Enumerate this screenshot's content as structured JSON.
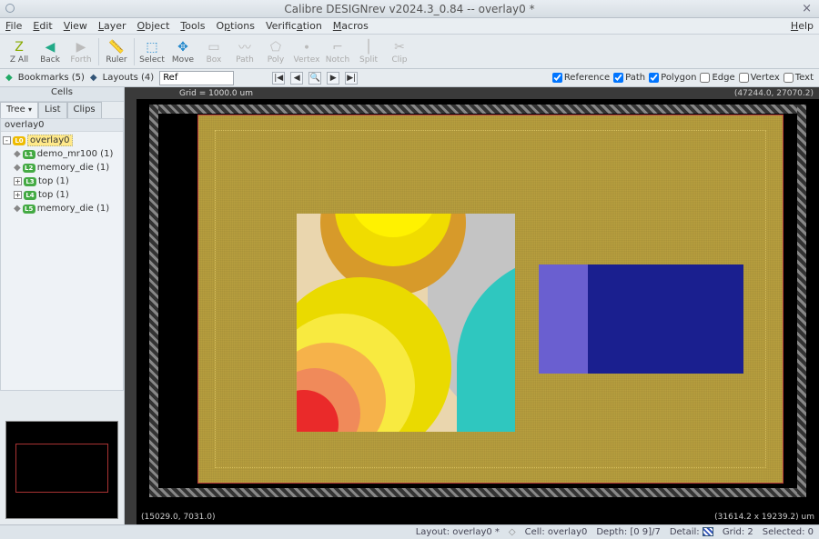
{
  "window": {
    "title": "Calibre DESIGNrev v2024.3_0.84  --  overlay0 *"
  },
  "menu": {
    "file": "File",
    "edit": "Edit",
    "view": "View",
    "layer": "Layer",
    "object": "Object",
    "tools": "Tools",
    "options": "Options",
    "verification": "Verification",
    "macros": "Macros",
    "help": "Help"
  },
  "toolbar": {
    "zall": "Z All",
    "back": "Back",
    "forth": "Forth",
    "ruler": "Ruler",
    "select": "Select",
    "move": "Move",
    "box": "Box",
    "path": "Path",
    "poly": "Poly",
    "vertex": "Vertex",
    "notch": "Notch",
    "split": "Split",
    "clip": "Clip"
  },
  "secbar": {
    "bookmarks": "Bookmarks (5)",
    "layouts": "Layouts (4)",
    "ref_value": "Ref",
    "nav_first": "|◀",
    "nav_prev": "◀",
    "nav_zoom": "🔍",
    "nav_next": "▶",
    "nav_last": "▶|"
  },
  "checks": {
    "reference": "Reference",
    "path": "Path",
    "polygon": "Polygon",
    "edge": "Edge",
    "vertex": "Vertex",
    "text": "Text"
  },
  "sidebar": {
    "header": "Cells",
    "tabs": {
      "tree": "Tree",
      "list": "List",
      "clips": "Clips"
    },
    "root": "overlay0",
    "items": [
      {
        "badge": "L0",
        "label": "overlay0",
        "hl": true
      },
      {
        "badge": "L1",
        "label": "demo_mr100  (1)"
      },
      {
        "badge": "L2",
        "label": "memory_die  (1)"
      },
      {
        "badge": "L3",
        "label": "top  (1)"
      },
      {
        "badge": "L4",
        "label": "top  (1)"
      },
      {
        "badge": "L5",
        "label": "memory_die  (1)"
      }
    ]
  },
  "canvas": {
    "grid_label": "Grid = 1000.0 um",
    "coord_tr": "(47244.0, 27070.2)",
    "coord_bl": "(15029.0, 7031.0)",
    "coord_br": "(31614.2 x 19239.2) um"
  },
  "status": {
    "layout": "Layout: overlay0 *",
    "cell": "Cell: overlay0",
    "depth": "Depth: [0 9]/7",
    "detail": "Detail:",
    "grid": "Grid: 2",
    "selected": "Selected: 0"
  }
}
